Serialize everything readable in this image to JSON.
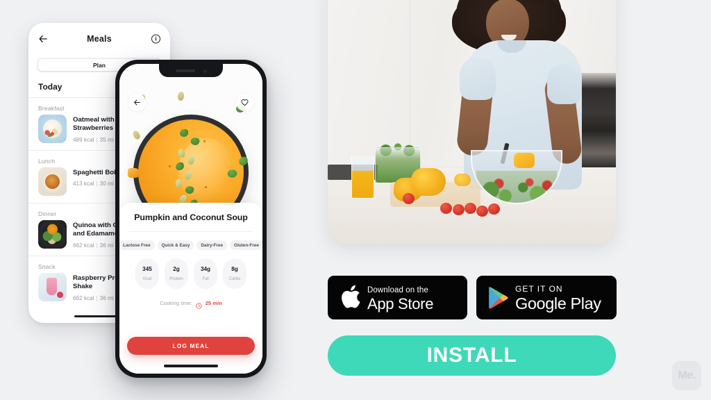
{
  "app_promo": {
    "install_button": "INSTALL",
    "accent_color": "#3ed9b8",
    "cta_color": "#e0423d",
    "background_color": "#f0f1f3",
    "watermark": "Me."
  },
  "store_badges": [
    {
      "small": "Download on the",
      "big": "App Store",
      "icon": "apple-icon"
    },
    {
      "small": "GET IT ON",
      "big": "Google Play",
      "icon": "google-play-icon"
    }
  ],
  "photo": {
    "alt": "Woman smiling while preparing a fresh salad in a bright kitchen"
  },
  "meals_screen": {
    "back_icon": "back-arrow-icon",
    "title": "Meals",
    "info_icon": "info-icon",
    "tabs": [
      "Plan"
    ],
    "active_tab": "Plan",
    "day_label": "Today",
    "sections": [
      {
        "label": "Breakfast",
        "meal": {
          "name": "Oatmeal with A\nStrawberries",
          "name_line1": "Oatmeal with A",
          "name_line2": "Strawberries",
          "kcal": "489 kcal",
          "time": "35 mi",
          "thumb": "th-oatmeal"
        }
      },
      {
        "label": "Lunch",
        "meal": {
          "name_line1": "Spaghetti Bolo",
          "name_line2": "",
          "kcal": "413 kcal",
          "time": "30 mi",
          "thumb": "th-spaghetti"
        }
      },
      {
        "label": "Dinner",
        "meal": {
          "name_line1": "Quinoa with Gr",
          "name_line2": "and Edamame",
          "kcal": "662 kcal",
          "time": "36 mi",
          "thumb": "th-quinoa"
        }
      },
      {
        "label": "Snack",
        "meal": {
          "name_line1": "Raspberry Prote",
          "name_line2": "Shake",
          "kcal": "662 kcal",
          "time": "36 mi",
          "thumb": "th-shake"
        }
      }
    ],
    "stat_divider": "|"
  },
  "recipe_screen": {
    "back_icon": "back-arrow-icon",
    "favorite_icon": "heart-icon",
    "hero_alt": "Top-down bowl of pumpkin and coconut soup with parsley and pumpkin seeds",
    "title": "Pumpkin and Coconut Soup",
    "tags": [
      "Lactose Free",
      "Quick & Easy",
      "Dairy-Free",
      "Gluten-Free"
    ],
    "nutrition": [
      {
        "value": "345",
        "label": "Kcal"
      },
      {
        "value": "2g",
        "label": "Protein"
      },
      {
        "value": "34g",
        "label": "Fat"
      },
      {
        "value": "8g",
        "label": "Carbs"
      }
    ],
    "cooking_time_label": "Cooking time:",
    "cooking_time_value": "25 min",
    "clock_icon": "clock-icon",
    "cta": "LOG MEAL"
  }
}
